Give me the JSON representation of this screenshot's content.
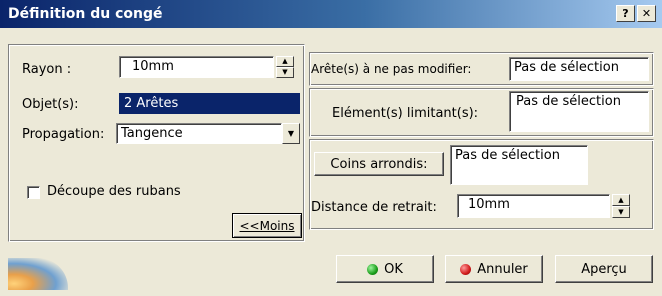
{
  "window": {
    "title": "Définition du congé",
    "help_btn": "?",
    "close_btn": "✕"
  },
  "left": {
    "rayon_label": "Rayon :",
    "rayon_value": "10mm",
    "objet_label": "Objet(s):",
    "objet_value": "2 Arêtes",
    "propagation_label": "Propagation:",
    "propagation_value": "Tangence",
    "decoupe_label": "Découpe des rubans",
    "decoupe_checked": false,
    "moins_button": "<<Moins"
  },
  "right": {
    "aretes_label": "Arête(s) à ne pas modifier:",
    "aretes_value": "Pas de sélection",
    "elements_label": "Elément(s) limitant(s):",
    "elements_value": "Pas de sélection",
    "coins_button": "Coins arrondis:",
    "coins_value": "Pas de sélection",
    "distance_label": "Distance de retrait:",
    "distance_value": "10mm"
  },
  "footer": {
    "ok_button": "OK",
    "annuler_button": "Annuler",
    "apercu_button": "Aperçu"
  },
  "icons": {
    "ok_icon": "green-dot-icon",
    "annuler_icon": "red-dot-icon",
    "spin_up": "▲",
    "spin_down": "▼",
    "combo_arrow": "▼"
  }
}
